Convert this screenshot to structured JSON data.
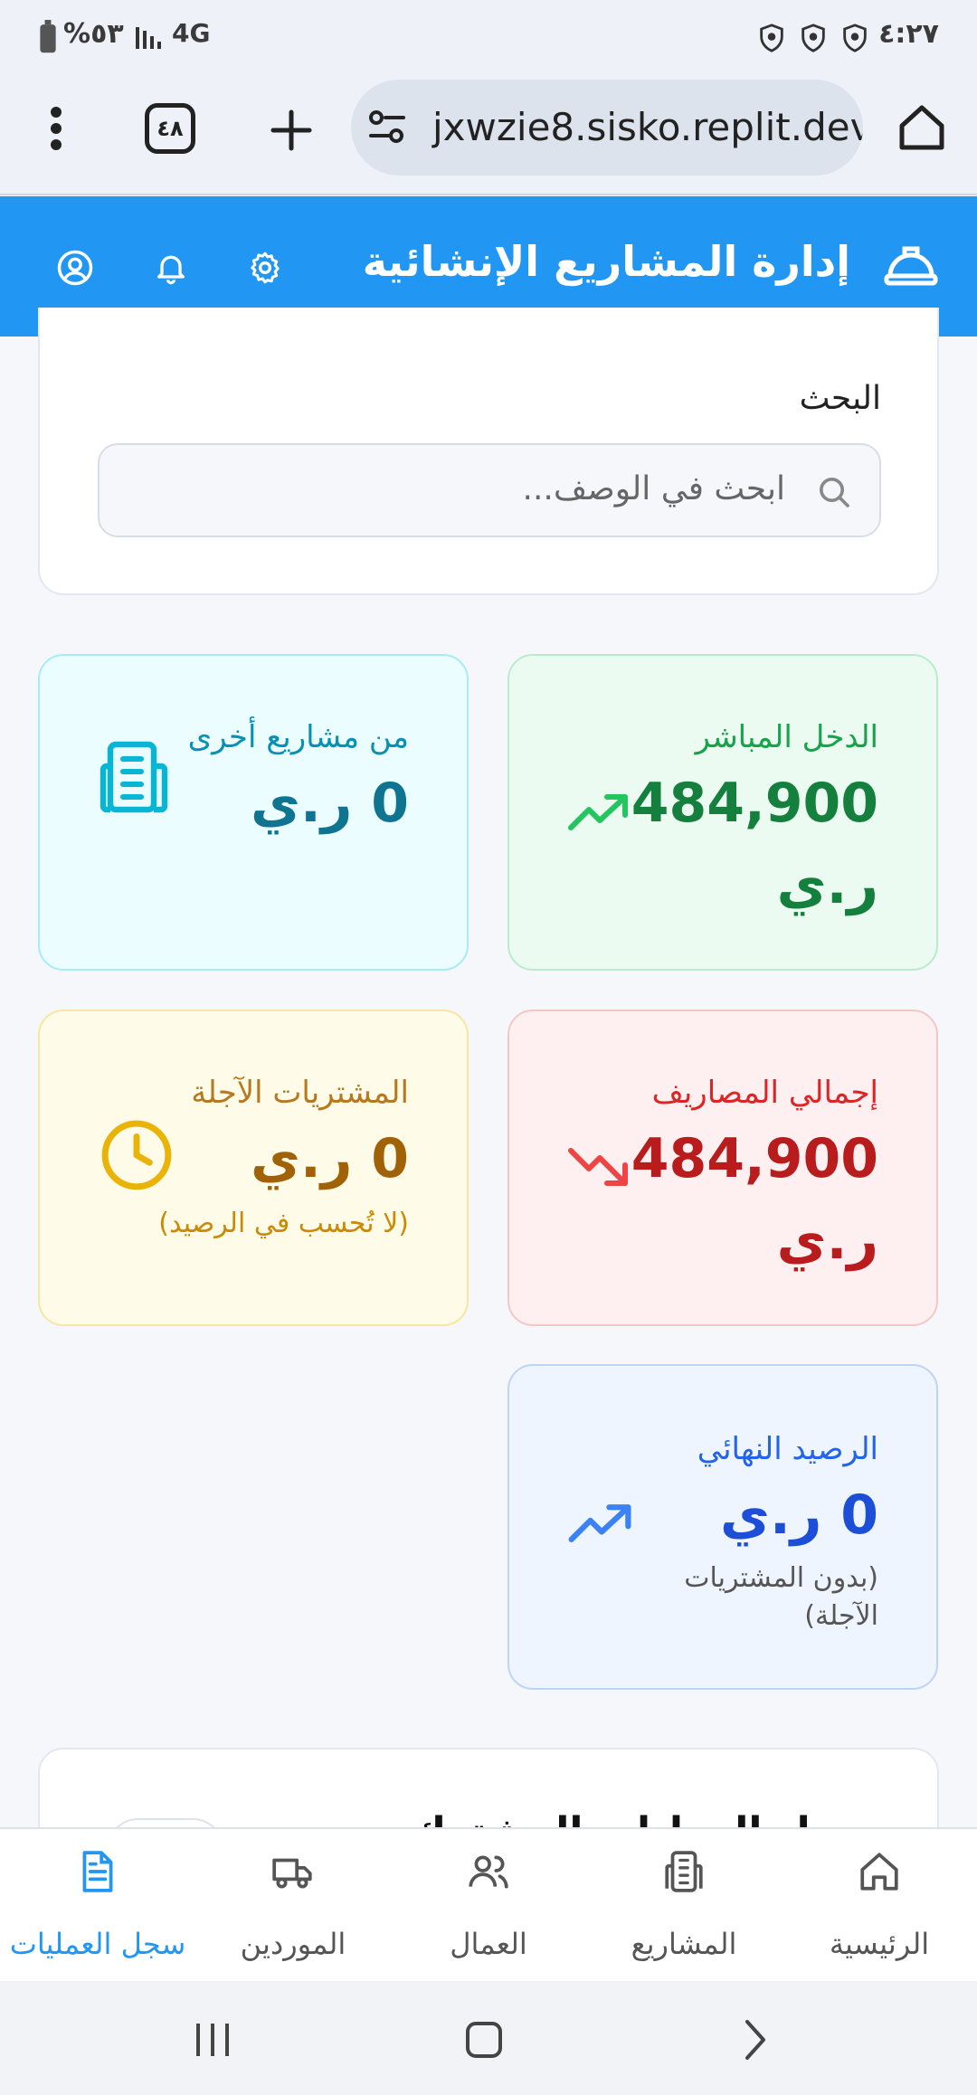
{
  "status_bar": {
    "time": "٤:٢٧",
    "battery": "%٥٣",
    "network": "4G"
  },
  "browser": {
    "url": "jxwzie8.sisko.replit.dev",
    "tab_count": "٤٨"
  },
  "header": {
    "title": "إدارة المشاريع الإنشائية"
  },
  "search": {
    "label": "البحث",
    "placeholder": "ابحث في الوصف..."
  },
  "cards": {
    "direct_income": {
      "title": "الدخل المباشر",
      "value": "484,900",
      "currency": "ر.ي",
      "color": "#15803d"
    },
    "other_projects": {
      "title": "من مشاريع أخرى",
      "value": "0 ر.ي",
      "color": "#0e7490"
    },
    "total_expenses": {
      "title": "إجمالي المصاريف",
      "value": "484,900",
      "currency": "ر.ي",
      "color": "#b91c1c"
    },
    "deferred_purchases": {
      "title": "المشتريات الآجلة",
      "value": "0 ر.ي",
      "note": "(لا تُحسب في الرصيد)",
      "color": "#a16207"
    },
    "final_balance": {
      "title": "الرصيد النهائي",
      "value": "0 ر.ي",
      "note_line1": "(بدون المشتريات",
      "note_line2": "الآجلة)",
      "color": "#1d4ed8"
    }
  },
  "section_peek": {
    "title": "سجل العمليات المشترك"
  },
  "bottom_nav": {
    "items": [
      {
        "label": "الرئيسية",
        "icon": "home-icon"
      },
      {
        "label": "المشاريع",
        "icon": "building-icon"
      },
      {
        "label": "العمال",
        "icon": "users-icon"
      },
      {
        "label": "الموردين",
        "icon": "truck-icon"
      },
      {
        "label": "سجل العمليات",
        "icon": "file-text-icon",
        "active": true
      }
    ]
  }
}
